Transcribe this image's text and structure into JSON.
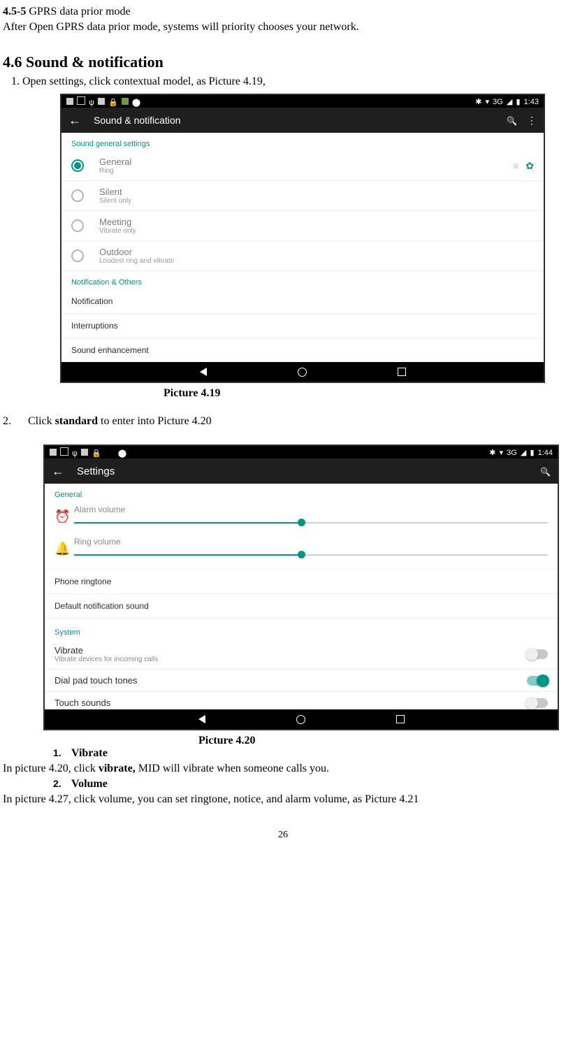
{
  "doc": {
    "heading455_num": "4.5-5",
    "heading455_title": " GPRS data prior mode",
    "p455": "After Open GPRS data prior mode, systems will priority chooses your network.",
    "heading46": "4.6 Sound & notification",
    "step1": "1. Open settings, click contextual model, as Picture 4.19,",
    "caption1": "Picture 4.19",
    "step2_num": "2.",
    "step2_pre": "Click ",
    "step2_bold": "standard",
    "step2_post": " to enter into Picture 4.20",
    "caption2": "Picture 4.20",
    "sub1_num": "1.",
    "sub1_label": "Vibrate",
    "sub1_text_pre": "In picture 4.20, click ",
    "sub1_text_bold": "vibrate,",
    "sub1_text_post": " MID will vibrate when someone calls you.",
    "sub2_num": "2.",
    "sub2_label": "Volume",
    "sub2_text": "In picture 4.27, click volume, you can set ringtone, notice, and alarm volume, as Picture 4.21",
    "page_number": "26"
  },
  "shot1": {
    "time": "1:43",
    "net": "3G",
    "appbar_title": "Sound & notification",
    "sec_general": "Sound general settings",
    "profiles": [
      {
        "title": "General",
        "sub": "Ring",
        "checked": true
      },
      {
        "title": "Silent",
        "sub": "Silent only",
        "checked": false
      },
      {
        "title": "Meeting",
        "sub": "Vibrate only",
        "checked": false
      },
      {
        "title": "Outdoor",
        "sub": "Loudest ring and vibrate",
        "checked": false
      }
    ],
    "sec_other": "Notification & Others",
    "rows": [
      "Notification",
      "Interruptions",
      "Sound enhancement"
    ]
  },
  "shot2": {
    "time": "1:44",
    "net": "3G",
    "appbar_title": "Settings",
    "sec_general": "General",
    "alarm_label": "Alarm volume",
    "ring_label": "Ring volume",
    "alarm_pct": 48,
    "ring_pct": 48,
    "row_ringtone": "Phone ringtone",
    "row_default_notif": "Default notification sound",
    "sec_system": "System",
    "vibrate_title": "Vibrate",
    "vibrate_sub": "Vibrate devices for incoming calls",
    "dialpad": "Dial pad touch tones",
    "touch": "Touch sounds"
  }
}
